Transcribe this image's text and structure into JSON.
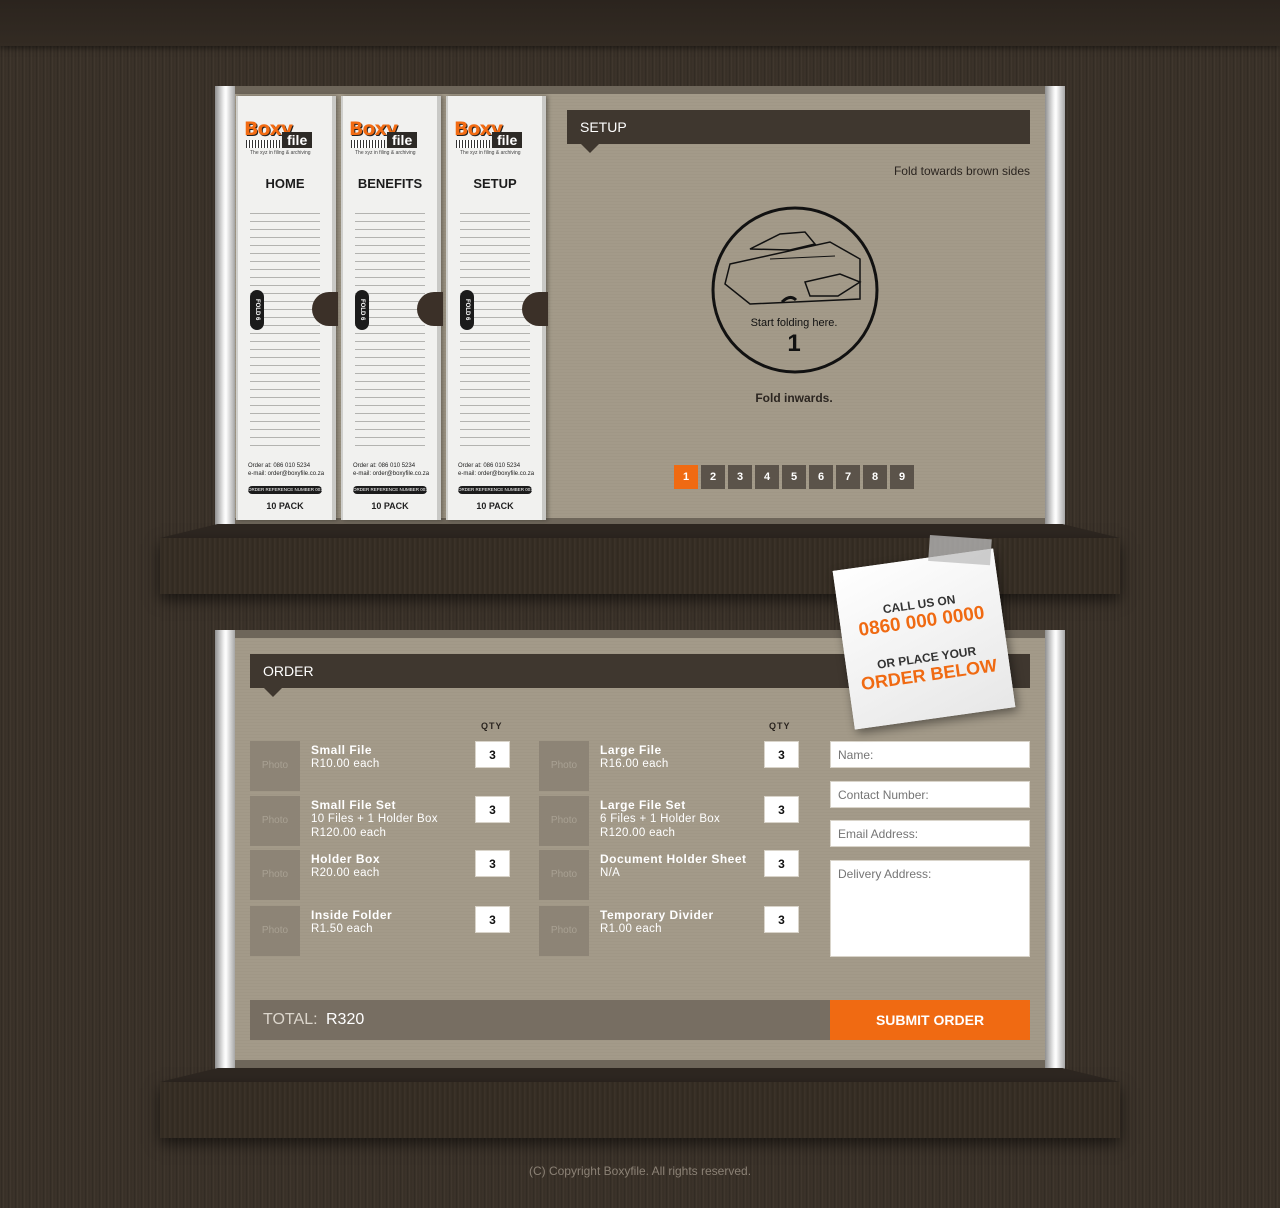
{
  "binders": [
    {
      "title": "HOME",
      "fold": "FOLD 6",
      "order_at": "Order at: 086 010 5234",
      "email": "e-mail: order@boxyfile.co.za",
      "ref": "ORDER REFERENCE NUMBER 001",
      "pack": "10 PACK"
    },
    {
      "title": "BENEFITS",
      "fold": "FOLD 6",
      "order_at": "Order at: 086 010 5234",
      "email": "e-mail: order@boxyfile.co.za",
      "ref": "ORDER REFERENCE NUMBER 001",
      "pack": "10 PACK"
    },
    {
      "title": "SETUP",
      "fold": "FOLD 6",
      "order_at": "Order at: 086 010 5234",
      "email": "e-mail: order@boxyfile.co.za",
      "ref": "ORDER REFERENCE NUMBER 001",
      "pack": "10 PACK"
    }
  ],
  "logo": {
    "boxy": "Boxy",
    "file": "file",
    "tagline": "The xyz in filing & archiving"
  },
  "setup": {
    "heading": "SETUP",
    "fold_note": "Fold towards brown sides",
    "illustration_caption": "Start folding here.",
    "illustration_step": "1",
    "instruction": "Fold inwards.",
    "pages": [
      "1",
      "2",
      "3",
      "4",
      "5",
      "6",
      "7",
      "8",
      "9"
    ],
    "active_page": "1"
  },
  "note": {
    "line1": "CALL US ON",
    "phone": "0860 000 0000",
    "line3": "OR PLACE YOUR",
    "line4": "ORDER BELOW"
  },
  "order": {
    "heading": "ORDER",
    "qty_label": "QTY",
    "photo_label": "Photo",
    "items_left": [
      {
        "name": "Small File",
        "desc1": "R10.00 each",
        "desc2": "",
        "qty": "3"
      },
      {
        "name": "Small File Set",
        "desc1": "10 Files + 1 Holder Box",
        "desc2": "R120.00 each",
        "qty": "3"
      },
      {
        "name": "Holder Box",
        "desc1": "R20.00 each",
        "desc2": "",
        "qty": "3"
      },
      {
        "name": "Inside Folder",
        "desc1": "R1.50 each",
        "desc2": "",
        "qty": "3"
      }
    ],
    "items_right": [
      {
        "name": "Large File",
        "desc1": "R16.00 each",
        "desc2": "",
        "qty": "3"
      },
      {
        "name": "Large File Set",
        "desc1": "6 Files + 1 Holder Box",
        "desc2": "R120.00 each",
        "qty": "3"
      },
      {
        "name": "Document Holder Sheet",
        "desc1": "N/A",
        "desc2": "",
        "qty": "3"
      },
      {
        "name": "Temporary Divider",
        "desc1": "R1.00 each",
        "desc2": "",
        "qty": "3"
      }
    ],
    "fields": {
      "name": "Name:",
      "contact": "Contact Number:",
      "email": "Email Address:",
      "address": "Delivery Address:"
    },
    "total_label": "TOTAL:",
    "total_value": "R320",
    "submit_label": "SUBMIT ORDER"
  },
  "footer": {
    "copyright": "(C) Copyright Boxyfile. All rights reserved."
  },
  "colors": {
    "accent": "#f06a12",
    "header": "#3f372f",
    "panel": "#a39a89"
  }
}
